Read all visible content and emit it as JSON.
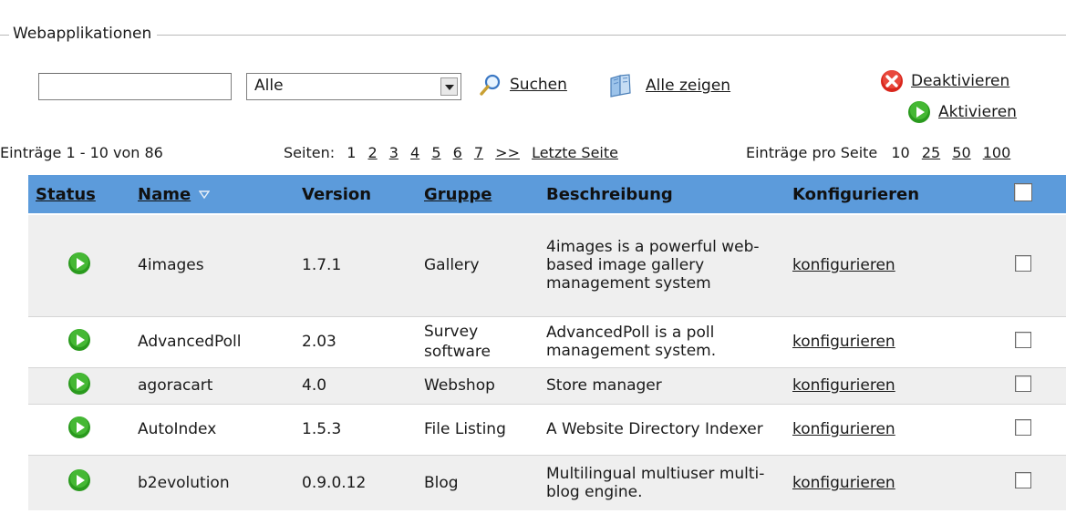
{
  "fieldset": {
    "legend": "Webapplikationen"
  },
  "filter": {
    "search_value": "",
    "category_selected": "Alle",
    "search_label": "Suchen",
    "show_all_label": "Alle zeigen"
  },
  "actions": {
    "deactivate_label": "Deaktivieren",
    "activate_label": "Aktivieren"
  },
  "info": {
    "entries_text": "Einträge 1 - 10 von 86",
    "pages_label": "Seiten:",
    "pages": [
      "1",
      "2",
      "3",
      "4",
      "5",
      "6",
      "7",
      ">>"
    ],
    "last_page_label": "Letzte Seite",
    "per_page_label": "Einträge pro Seite",
    "per_page_options": [
      "10",
      "25",
      "50",
      "100"
    ]
  },
  "table": {
    "headers": {
      "status": "Status",
      "name": "Name",
      "version": "Version",
      "group": "Gruppe",
      "description": "Beschreibung",
      "configure": "Konfigurieren"
    },
    "configure_link": "konfigurieren",
    "rows": [
      {
        "name": "4images",
        "version": "1.7.1",
        "group": "Gallery",
        "description": "4images is a powerful web-based image gallery management system"
      },
      {
        "name": "AdvancedPoll",
        "version": "2.03",
        "group": "Survey software",
        "description": "AdvancedPoll is a poll management system."
      },
      {
        "name": "agoracart",
        "version": "4.0",
        "group": "Webshop",
        "description": "Store manager"
      },
      {
        "name": "AutoIndex",
        "version": "1.5.3",
        "group": "File Listing",
        "description": "A Website Directory Indexer"
      },
      {
        "name": "b2evolution",
        "version": "0.9.0.12",
        "group": "Blog",
        "description": "Multilingual multiuser multi-blog engine."
      }
    ]
  },
  "colors": {
    "header_bg": "#5c9bdb",
    "active_green": "#2a9a1e",
    "deactivate_red": "#d9261c"
  },
  "icons": {
    "search": "magnifier-icon",
    "show_all": "book-icon",
    "deactivate": "red-x-icon",
    "activate": "green-play-icon",
    "status": "green-play-icon",
    "sort": "sort-down-icon"
  }
}
